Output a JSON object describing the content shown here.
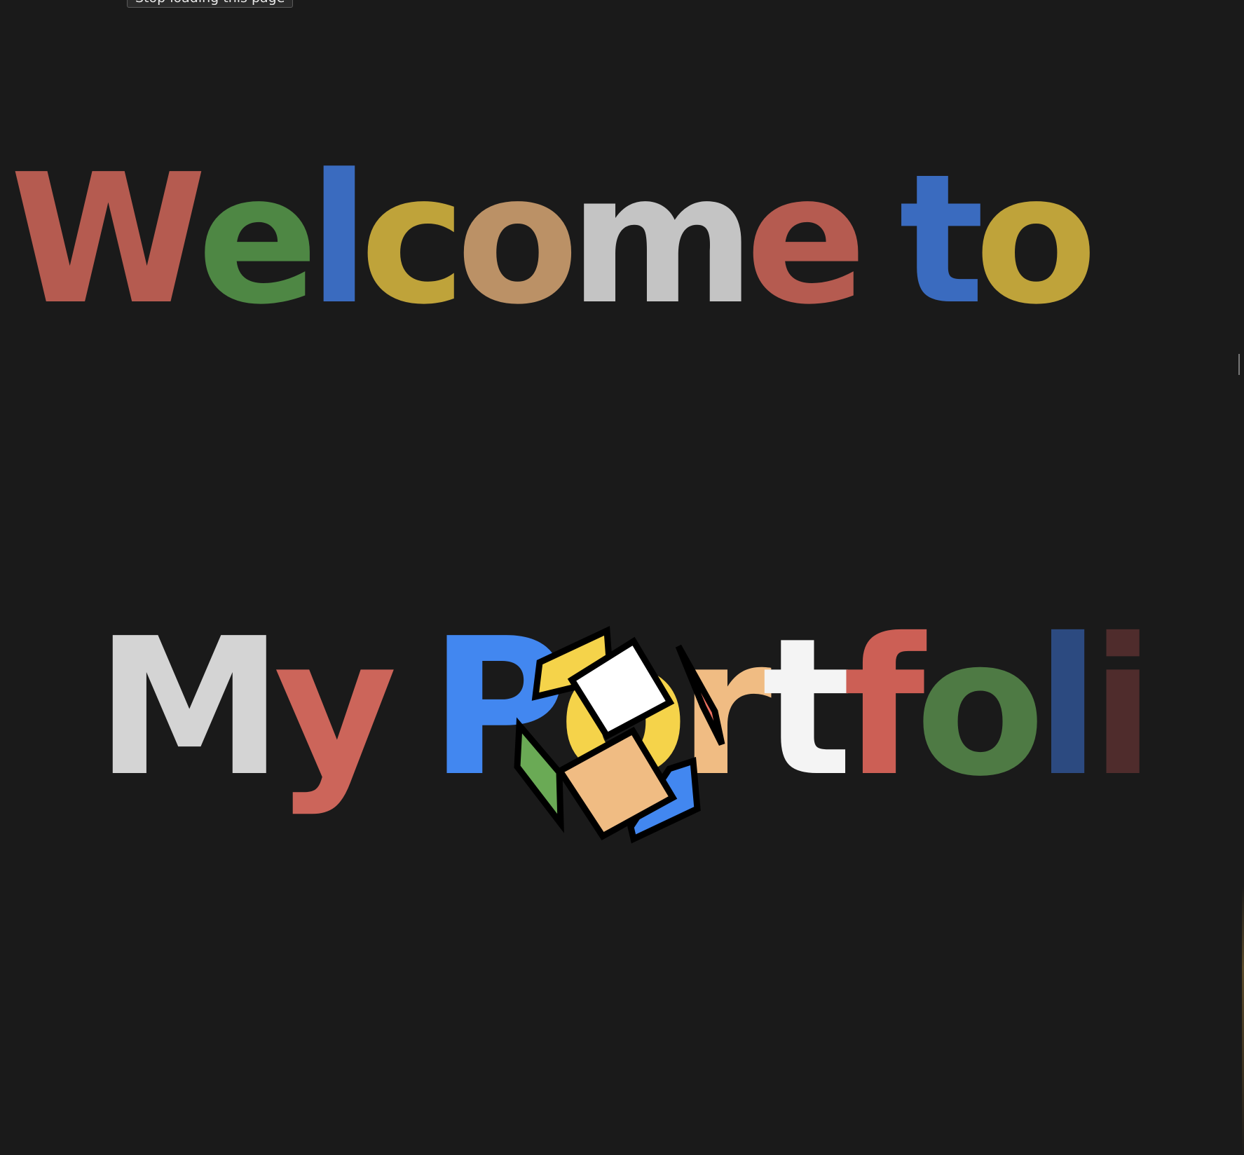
{
  "tooltip": {
    "text": "Stop loading this page"
  },
  "heading_line1": {
    "letters": [
      {
        "char": "W",
        "color": "#b55b50"
      },
      {
        "char": "e",
        "color": "#4e8744"
      },
      {
        "char": "l",
        "color": "#3a6bbf"
      },
      {
        "char": "c",
        "color": "#bfa33a"
      },
      {
        "char": "o",
        "color": "#bb9166"
      },
      {
        "char": "m",
        "color": "#c4c4c4"
      },
      {
        "char": "e",
        "color": "#b55b50"
      },
      {
        "char": " ",
        "color": "#1a1a1a"
      },
      {
        "char": "t",
        "color": "#3a6bbf"
      },
      {
        "char": "o",
        "color": "#bfa33a"
      }
    ]
  },
  "heading_line2": {
    "letters": [
      {
        "char": "M",
        "color": "#d4d4d4"
      },
      {
        "char": "y",
        "color": "#cc655a"
      },
      {
        "char": " ",
        "color": "#1a1a1a"
      },
      {
        "char": "P",
        "color": "#4287f0"
      },
      {
        "char": "o",
        "color": "#f5d34a"
      },
      {
        "char": "r",
        "color": "#f0bc83"
      },
      {
        "char": "t",
        "color": "#f4f4f4"
      },
      {
        "char": "f",
        "color": "#cc5f55"
      },
      {
        "char": "o",
        "color": "#4e7a44"
      },
      {
        "char": "l",
        "color": "#2c4a80"
      },
      {
        "char": "i",
        "color": "#4f2c2c"
      }
    ]
  },
  "logo_colors": {
    "yellow": "#f5d34a",
    "white": "#ffffff",
    "red": "#ee7060",
    "green": "#6aaa55",
    "peach": "#f0bc83",
    "blue": "#4287f0",
    "outline": "#000000"
  },
  "background_color": "#1a1a1a"
}
